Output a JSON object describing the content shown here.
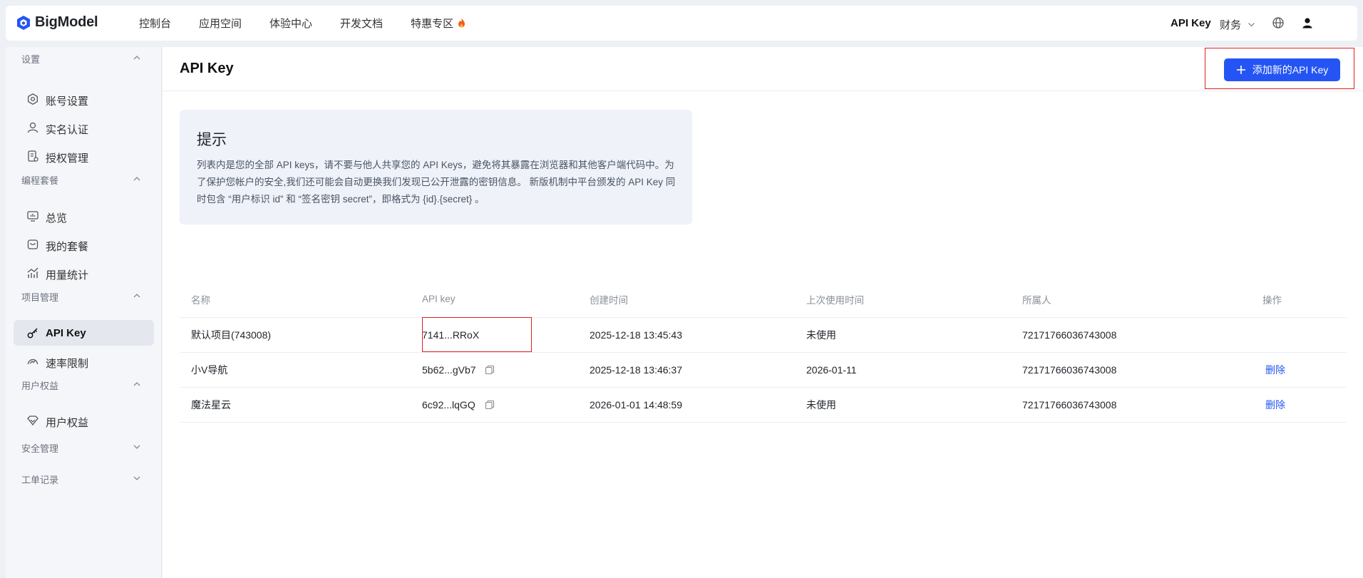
{
  "brand": {
    "name": "BigModel",
    "color": "#2455f4"
  },
  "topnav": {
    "items": [
      {
        "label": "控制台"
      },
      {
        "label": "应用空间"
      },
      {
        "label": "体验中心"
      },
      {
        "label": "开发文档"
      },
      {
        "label": "特惠专区",
        "icon": "fire-icon"
      }
    ],
    "right": {
      "api_key": "API Key",
      "finance": "财务",
      "globe_icon": "globe-icon",
      "user_icon": "user-icon"
    }
  },
  "sidebar": {
    "groups": [
      {
        "label": "设置",
        "expanded": true,
        "items": [
          {
            "label": "账号设置",
            "icon": "gear-icon"
          },
          {
            "label": "实名认证",
            "icon": "user-icon"
          },
          {
            "label": "授权管理",
            "icon": "document-icon"
          }
        ]
      },
      {
        "label": "编程套餐",
        "expanded": true,
        "items": [
          {
            "label": "总览",
            "icon": "monitor-icon"
          },
          {
            "label": "我的套餐",
            "icon": "package-icon"
          },
          {
            "label": "用量统计",
            "icon": "chart-icon"
          }
        ]
      },
      {
        "label": "项目管理",
        "expanded": true,
        "items": [
          {
            "label": "API Key",
            "icon": "key-icon",
            "active": true
          },
          {
            "label": "速率限制",
            "icon": "speed-icon"
          }
        ]
      },
      {
        "label": "用户权益",
        "expanded": true,
        "items": [
          {
            "label": "用户权益",
            "icon": "diamond-icon"
          }
        ]
      },
      {
        "label": "安全管理",
        "expanded": false,
        "items": []
      },
      {
        "label": "工单记录",
        "expanded": false,
        "items": []
      }
    ]
  },
  "page": {
    "title": "API Key",
    "add_button": "添加新的API Key",
    "tip": {
      "title": "提示",
      "body": "列表内是您的全部 API keys，请不要与他人共享您的 API Keys，避免将其暴露在浏览器和其他客户端代码中。为了保护您帐户的安全,我们还可能会自动更换我们发现已公开泄露的密钥信息。 新版机制中平台颁发的 API Key 同时包含 “用户标识 id” 和 “签名密钥 secret”，即格式为 {id}.{secret} 。"
    },
    "table": {
      "columns": [
        "名称",
        "API key",
        "创建时间",
        "上次使用时间",
        "所属人",
        "操作"
      ],
      "rows": [
        {
          "name": "默认项目(743008)",
          "key": "7141...RRoX",
          "created": "2025-12-18 13:45:43",
          "last_used": "未使用",
          "owner": "72171766036743008",
          "action": "",
          "copyable": false
        },
        {
          "name": "小V导航",
          "key": "5b62...gVb7",
          "created": "2025-12-18 13:46:37",
          "last_used": "2026-01-11",
          "owner": "72171766036743008",
          "action": "删除",
          "copyable": true
        },
        {
          "name": "魔法星云",
          "key": "6c92...lqGQ",
          "created": "2026-01-01 14:48:59",
          "last_used": "未使用",
          "owner": "72171766036743008",
          "action": "删除",
          "copyable": true
        }
      ]
    }
  },
  "highlight_color": "#e02020"
}
